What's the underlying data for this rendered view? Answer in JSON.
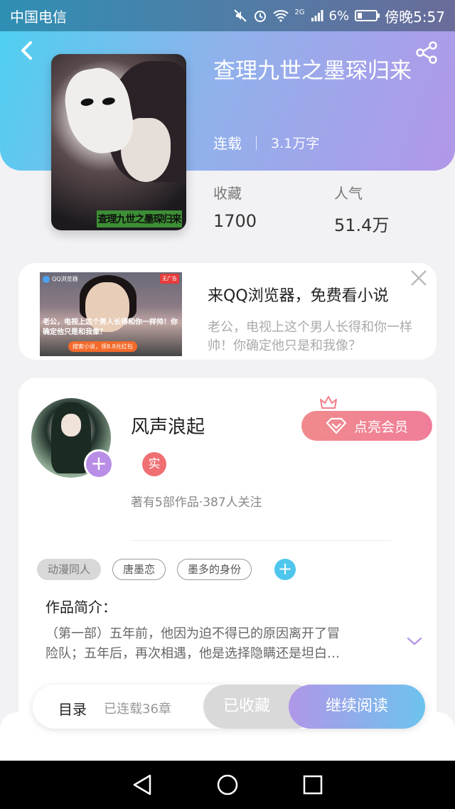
{
  "status_bar": {
    "carrier": "中国电信",
    "network": "2G",
    "battery": "6%",
    "time": "傍晚5:57"
  },
  "book": {
    "title": "查理九世之墨琛归来",
    "status": "连载",
    "word_count": "3.1万字",
    "cover_text": "查理九世之墨琛归来",
    "favorites_label": "收藏",
    "favorites_value": "1700",
    "popularity_label": "人气",
    "popularity_value": "51.4万"
  },
  "ad": {
    "title": "来QQ浏览器，免费看小说",
    "desc_line1": "老公，电视上这个男人长得和你一样",
    "desc_line2": "帅！你确定他只是和我像？",
    "image_brand": "QQ浏览器",
    "image_badge": "无广告",
    "image_caption": "老公，电视上这个男人长得和你一样帅！你确定他只是和我像？",
    "image_cta": "搜索小说，领8.8元红包"
  },
  "author": {
    "name": "风声浪起",
    "real_badge": "实",
    "stats": "著有5部作品·387人关注",
    "vip_button": "点亮会员"
  },
  "tags": [
    "动漫同人",
    "唐墨恋",
    "墨多的身份"
  ],
  "intro": {
    "label": "作品简介：",
    "text_line1": "（第一部）五年前，他因为迫不得已的原因离开了冒",
    "text_line2": "险队；五年后，再次相遇，他是选择隐瞒还是坦白…"
  },
  "bottom_bar": {
    "toc": "目录",
    "chapters": "已连载36章",
    "favorited": "已收藏",
    "continue_reading": "继续阅读"
  },
  "colors": {
    "header_start": "#4fd0f0",
    "header_end": "#b297e8",
    "vip_pink": "#f08a8c",
    "tag_add_blue": "#4ec6ee",
    "avatar_add_purple": "#b98ee6"
  }
}
